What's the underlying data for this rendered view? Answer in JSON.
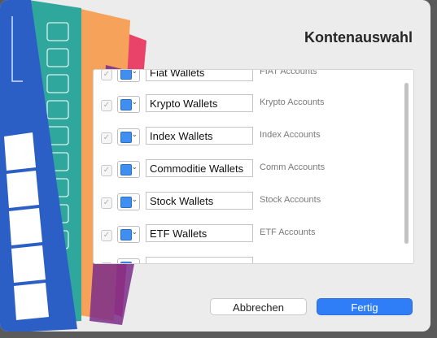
{
  "dialog": {
    "title": "Kontenauswahl",
    "cancel_label": "Abbrechen",
    "confirm_label": "Fertig"
  },
  "accounts": [
    {
      "name": "Fiat Wallets",
      "description": "FIAT Accounts",
      "checked": true
    },
    {
      "name": "Krypto Wallets",
      "description": "Krypto Accounts",
      "checked": true
    },
    {
      "name": "Index Wallets",
      "description": "Index Accounts",
      "checked": true
    },
    {
      "name": "Commoditie Wallets",
      "description": "Comm Accounts",
      "checked": true
    },
    {
      "name": "Stock Wallets",
      "description": "Stock Accounts",
      "checked": true
    },
    {
      "name": "ETF Wallets",
      "description": "ETF Accounts",
      "checked": true
    },
    {
      "name": "",
      "description": "",
      "checked": false
    }
  ],
  "colors": {
    "swatch": "#3f8ff0",
    "accent": "#2f7ef7"
  },
  "icons": {
    "checkbox": "checkmark-icon",
    "caret": "chevron-down-icon"
  }
}
